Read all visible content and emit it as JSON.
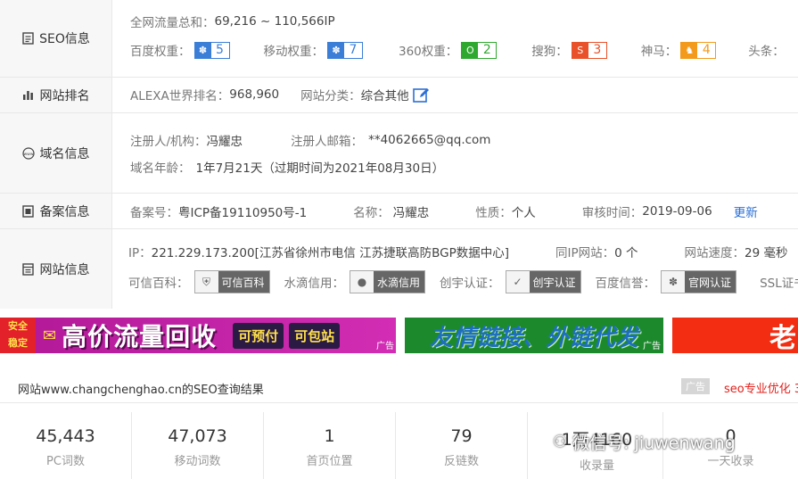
{
  "seo": {
    "label": "SEO信息",
    "traffic_key": "全网流量总和：",
    "traffic_value": "69,216 ~ 110,566IP",
    "weights": [
      {
        "name": "百度权重：",
        "value": "5",
        "color": "blue",
        "icon": "paw-icon"
      },
      {
        "name": "移动权重：",
        "value": "7",
        "color": "blue",
        "icon": "paw-icon"
      },
      {
        "name": "360权重：",
        "value": "2",
        "color": "green",
        "icon": "360-icon"
      },
      {
        "name": "搜狗：",
        "value": "3",
        "color": "red",
        "icon": "sogou-icon"
      },
      {
        "name": "神马：",
        "value": "4",
        "color": "orange",
        "icon": "shenma-icon"
      }
    ],
    "toutiao_key": "头条："
  },
  "rank": {
    "label": "网站排名",
    "alexa_key": "ALEXA世界排名：",
    "alexa_value": "968,960",
    "category_key": "网站分类：",
    "category_value": "综合其他"
  },
  "domain": {
    "label": "域名信息",
    "registrant_key": "注册人/机构：",
    "registrant_value": "冯耀忠",
    "email_key": "注册人邮箱：",
    "email_value": "**4062665@qq.com",
    "age_key": "域名年龄：",
    "age_value": "1年7月21天（过期时间为2021年08月30日）"
  },
  "icp": {
    "label": "备案信息",
    "number_key": "备案号：",
    "number_value": "粤ICP备19110950号-1",
    "name_key": "名称：",
    "name_value": "冯耀忠",
    "nature_key": "性质：",
    "nature_value": "个人",
    "date_key": "审核时间：",
    "date_value": "2019-09-06",
    "update_link": "更新"
  },
  "site": {
    "label": "网站信息",
    "ip_key": "IP：",
    "ip_value": "221.229.173.200[江苏省徐州市电信 江苏捷联高防BGP数据中心]",
    "sameip_key": "同IP网站：",
    "sameip_value": "0 个",
    "speed_key": "网站速度：",
    "speed_value": "29 毫秒",
    "certs": [
      {
        "key": "可信百科：",
        "badge": "可信百科"
      },
      {
        "key": "水滴信用：",
        "badge": "水滴信用"
      },
      {
        "key": "创宇认证：",
        "badge": "创宇认证"
      },
      {
        "key": "百度信誉：",
        "badge": "官网认证"
      }
    ],
    "ssl_key": "SSL证书："
  },
  "ads": {
    "ad1_badge_top": "安全",
    "ad1_badge_bottom": "稳定",
    "ad1_text": "高价流量回收",
    "ad1_btn1": "可预付",
    "ad1_btn2": "可包站",
    "ad1_tag": "广告",
    "ad2_text": "友情链接、外链代发",
    "ad2_tag": "广告",
    "ad3_text": "老"
  },
  "result": {
    "title": "网站www.changchenghao.cn的SEO查询结果",
    "ad_tag": "广告",
    "ad_link": "seo专业优化 3"
  },
  "stats": [
    {
      "num": "45,443",
      "label": "PC词数"
    },
    {
      "num": "47,073",
      "label": "移动词数"
    },
    {
      "num": "1",
      "label": "首页位置"
    },
    {
      "num": "79",
      "label": "反链数"
    },
    {
      "num": "1万4160",
      "label": "收录量"
    },
    {
      "num": "0",
      "label": "一天收录"
    }
  ],
  "watermark": "微信号: jiuwenwang"
}
